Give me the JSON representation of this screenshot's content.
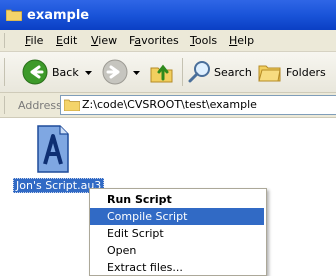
{
  "window": {
    "title": "example"
  },
  "menu": [
    {
      "label": "File",
      "key": "F",
      "rest": "ile"
    },
    {
      "label": "Edit",
      "key": "E",
      "rest": "dit"
    },
    {
      "label": "View",
      "key": "V",
      "rest": "iew"
    },
    {
      "label": "Favorites",
      "key": "a",
      "pre": "F",
      "rest": "vorites"
    },
    {
      "label": "Tools",
      "key": "T",
      "rest": "ools"
    },
    {
      "label": "Help",
      "key": "H",
      "rest": "elp"
    }
  ],
  "toolbar": {
    "back_label": "Back",
    "search_label": "Search",
    "folders_label": "Folders"
  },
  "address": {
    "label": "Address",
    "path": "Z:\\code\\CVSROOT\\test\\example"
  },
  "file": {
    "name": "Jon's Script.au3"
  },
  "context_menu": {
    "items": [
      "Run Script",
      "Compile Script",
      "Edit Script",
      "Open",
      "Extract files..."
    ],
    "default_item": "Run Script",
    "highlighted_item": "Compile Script"
  }
}
